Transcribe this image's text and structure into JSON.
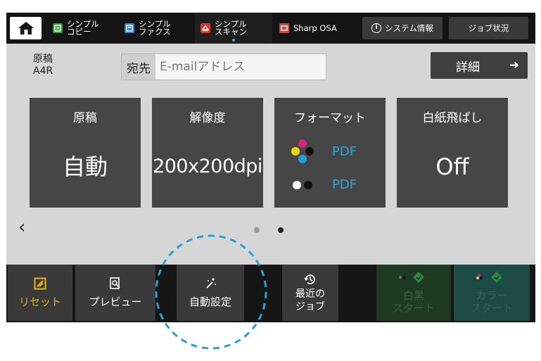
{
  "topbar": {
    "tabs": [
      {
        "label": "シンプル\nコピー",
        "icon": "copy-icon",
        "color": "#2e9d3a"
      },
      {
        "label": "シンプル\nファクス",
        "icon": "fax-icon",
        "color": "#2f83d6"
      },
      {
        "label": "シンプル\nスキャン",
        "icon": "scan-icon",
        "color": "#d8382f"
      },
      {
        "label": "Sharp OSA",
        "icon": "osa-icon",
        "color": "#c94a4a"
      }
    ],
    "system_info_label": "システム情報",
    "job_status_label": "ジョブ状況"
  },
  "settings": {
    "original_label": "原稿\nA4R",
    "dest_prefix": "宛先",
    "dest_placeholder": "E-mailアドレス",
    "detail_label": "詳細"
  },
  "tiles": [
    {
      "title": "原稿",
      "value": "自動"
    },
    {
      "title": "解像度",
      "value": "200x200dpi"
    },
    {
      "title": "フォーマット",
      "color_format": "PDF",
      "bw_format": "PDF"
    },
    {
      "title": "白紙飛ばし",
      "value": "Off"
    }
  ],
  "pager": {
    "current_page": 2,
    "total_pages": 2
  },
  "bottombar": {
    "reset_label": "リセット",
    "preview_label": "プレビュー",
    "auto_setting_label": "自動設定",
    "recent_jobs_label": "最近の\nジョブ",
    "bw_start_label": "白黒\nスタート",
    "color_start_label": "カラー\nスタート"
  },
  "colors": {
    "accent_blue": "#2aa7e0",
    "reset_yellow": "#e8b30e",
    "start_green": "#2e8a3a",
    "annotation": "#2a9fd6"
  }
}
